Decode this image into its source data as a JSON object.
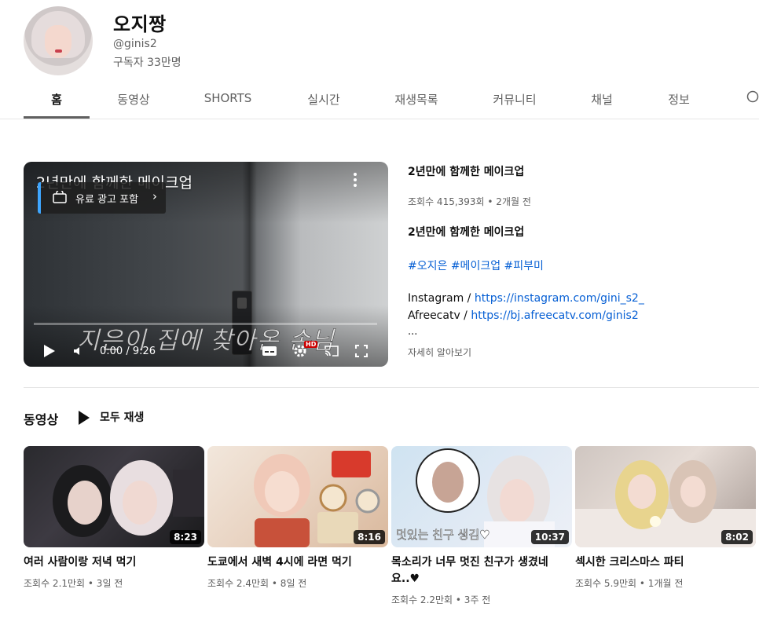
{
  "channel": {
    "name": "오지짱",
    "handle": "@ginis2",
    "subscribers": "구독자 33만명"
  },
  "tabs": [
    {
      "label": "홈",
      "active": true
    },
    {
      "label": "동영상"
    },
    {
      "label": "SHORTS"
    },
    {
      "label": "실시간"
    },
    {
      "label": "재생목록"
    },
    {
      "label": "커뮤니티"
    },
    {
      "label": "채널"
    },
    {
      "label": "정보"
    }
  ],
  "featured": {
    "player_title": "2년만에 함께한 메이크업",
    "paid_promotion": "유료 광고 포함",
    "caption": "지은이 집에 찾아온 손님",
    "time": "0:00 / 9:26",
    "progress": 0,
    "title": "2년만에 함께한 메이크업",
    "meta": "조회수 415,393회 • 2개월 전",
    "description": "2년만에 함께한 메이크업",
    "hashtags": [
      "#오지은",
      "#메이크업",
      "#피부미"
    ],
    "links": [
      {
        "label": "Instagram / ",
        "url": "https://instagram.com/gini_s2_"
      },
      {
        "label": "Afreecatv / ",
        "url": "https://bj.afreecatv.com/ginis2"
      }
    ],
    "ellipsis": "...",
    "read_more": "자세히 알아보기"
  },
  "shelf": {
    "title": "동영상",
    "play_all": "모두 재생",
    "videos": [
      {
        "title": "여러 사람이랑 저녁 먹기",
        "meta": "조회수 2.1만회 • 3일 전",
        "duration": "8:23"
      },
      {
        "title": "도쿄에서 새벽 4시에 라면 먹기",
        "meta": "조회수 2.4만회 • 8일 전",
        "duration": "8:16"
      },
      {
        "title": "목소리가 너무 멋진 친구가 생겼네요..♥",
        "meta": "조회수 2.2만회 • 3주 전",
        "duration": "10:37",
        "thumb_text": "멋있는 친구 생김♥"
      },
      {
        "title": "섹시한 크리스마스 파티",
        "meta": "조회수 5.9만회 • 1개월 전",
        "duration": "8:02"
      }
    ]
  },
  "colors": {
    "link": "#065fd4",
    "progress": "#ff0000",
    "secondary_text": "#606060"
  }
}
